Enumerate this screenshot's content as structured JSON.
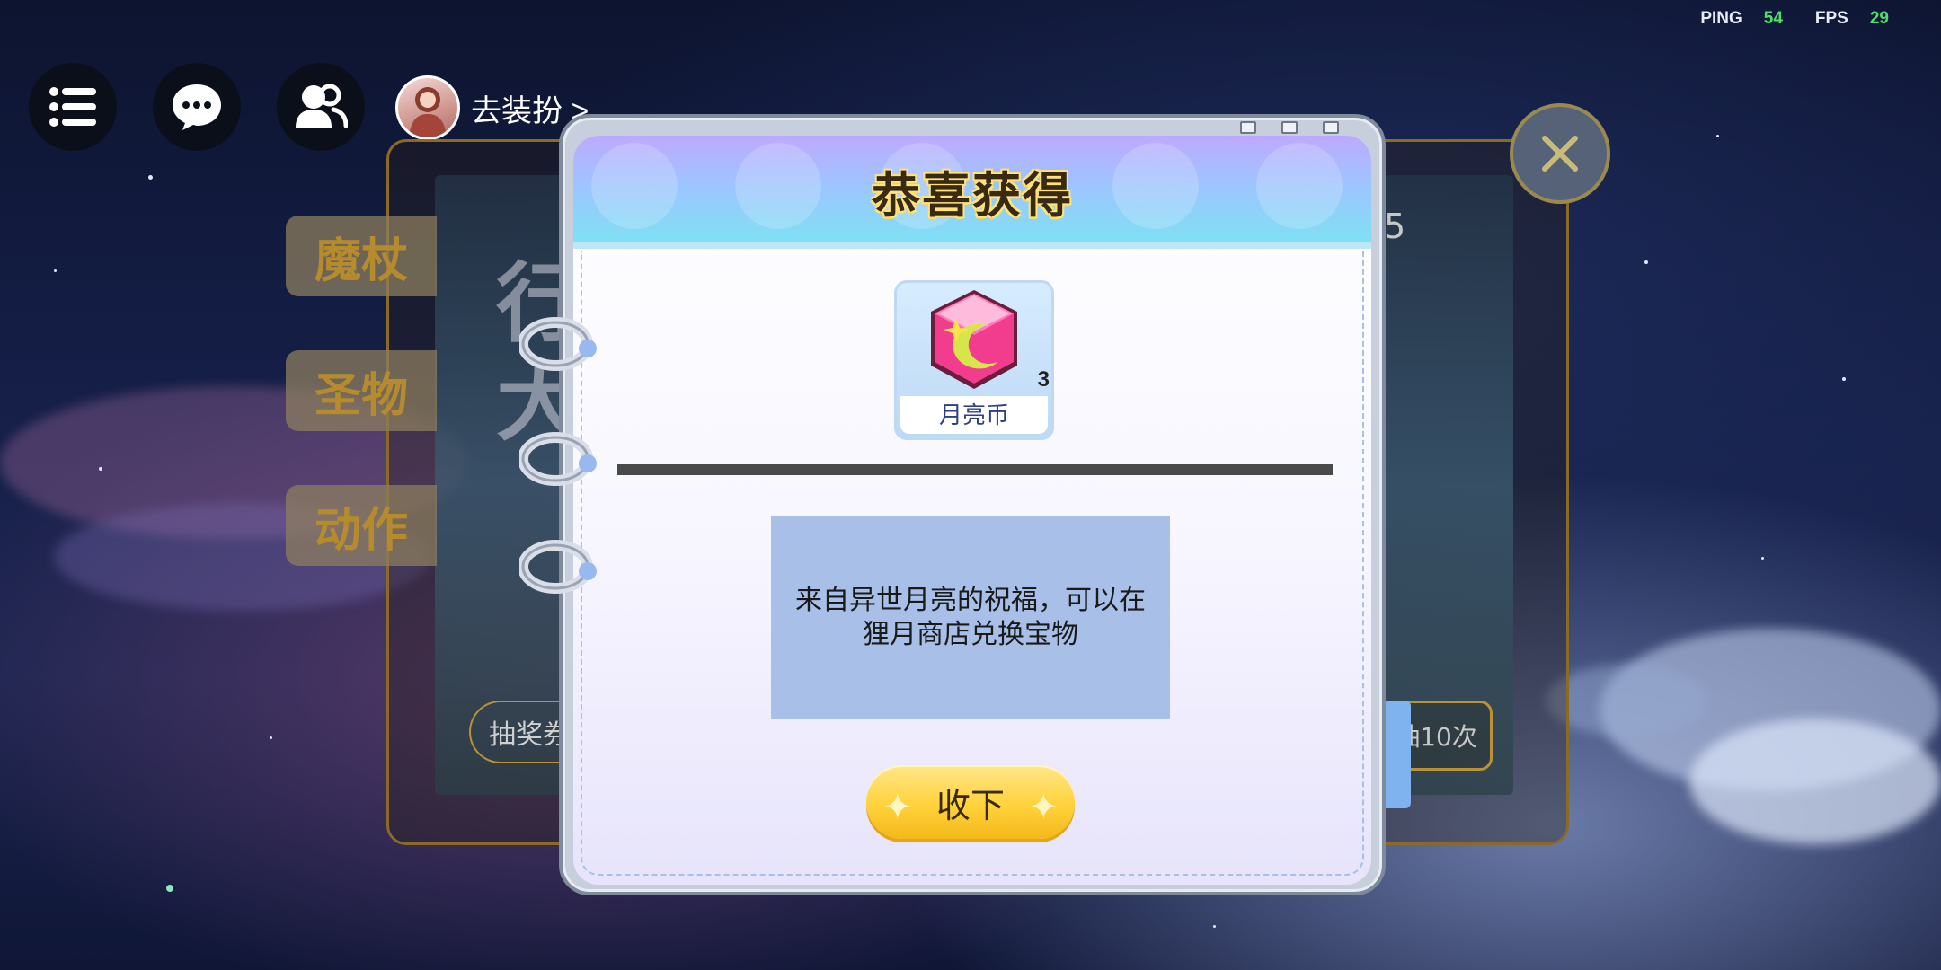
{
  "stats": {
    "ping_label": "PING",
    "ping_value": "54",
    "fps_label": "FPS",
    "fps_value": "29"
  },
  "topbar": {
    "menu_icon": "menu-icon",
    "chat_icon": "chat-icon",
    "friends_icon": "friends-icon",
    "dress_up_label": "去装扮 >"
  },
  "background_panel": {
    "side_tabs": [
      "魔杖",
      "圣物",
      "动作"
    ],
    "ghost_text_1": "行",
    "ghost_text_2": "大",
    "ticket_label": "抽奖券",
    "draw_ten_label": "抽10次",
    "partial_number": "5"
  },
  "modal": {
    "title": "恭喜获得",
    "item": {
      "name": "月亮币",
      "count": "3",
      "icon": "moon-coin-icon"
    },
    "description": "来自异世月亮的祝福，可以在狸月商店兑换宝物",
    "accept_label": "收下"
  },
  "colors": {
    "accent_yellow": "#ffd23a",
    "header_blue": "#7fe0f4",
    "desc_bg": "#a8bfe8",
    "ping_green": "#4ee06b"
  }
}
